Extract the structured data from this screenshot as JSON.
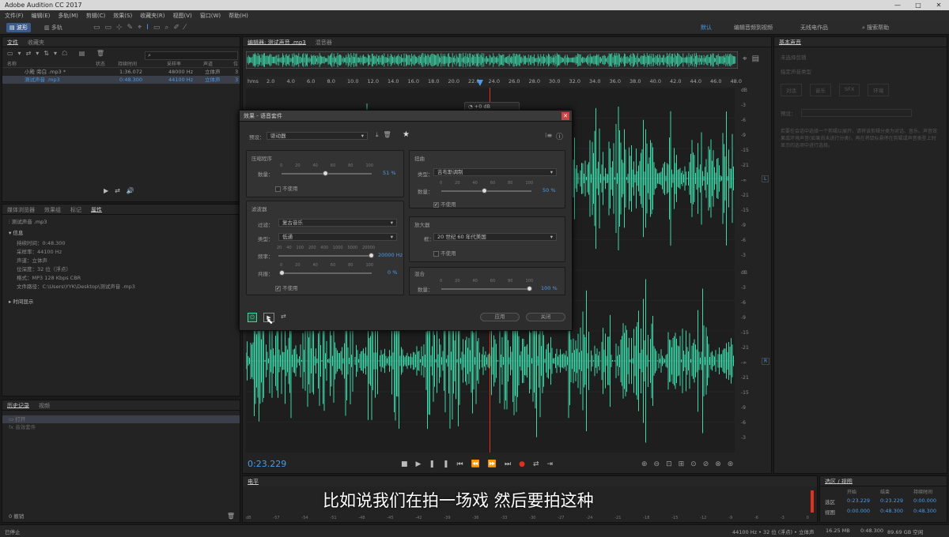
{
  "app": {
    "title": "Adobe Audition CC 2017",
    "win_min": "—",
    "win_max": "□",
    "win_close": "✕"
  },
  "menu": [
    "文件(F)",
    "编辑(E)",
    "多轨(M)",
    "剪辑(C)",
    "效果(S)",
    "收藏夹(R)",
    "视图(V)",
    "窗口(W)",
    "帮助(H)"
  ],
  "toolbar": {
    "mode_wave": "波形",
    "mode_multi": "多轨",
    "workspace": "默认",
    "workspace2": "编辑音频到视频",
    "workspace3": "无线电作品",
    "search_placeholder": "搜索帮助"
  },
  "files": {
    "tabs": [
      "文件",
      "收藏夹"
    ],
    "headers": [
      "名称",
      "状态",
      "持续时间",
      "采样率",
      "声道",
      "位"
    ],
    "rows": [
      {
        "name": "小殿 旁白 .mp3 *",
        "dur": "1:36.072",
        "rate": "48000 Hz",
        "ch": "立体声",
        "bits": "3"
      },
      {
        "name": "测试声音 .mp3",
        "dur": "0:48.300",
        "rate": "44100 Hz",
        "ch": "立体声",
        "bits": "3"
      }
    ]
  },
  "props": {
    "tabs": [
      "媒体浏览器",
      "效果组",
      "标记",
      "属性"
    ],
    "filename": "测试声音 .mp3",
    "section": "信息",
    "items": [
      "持续时间：0:48.300",
      "采样率：44100 Hz",
      "声道：立体声",
      "位深度：32 位（浮点）",
      "格式：MP3 128 Kbps CBR",
      "文件路径：C:\\Users\\YYK\\Desktop\\测试声音 .mp3"
    ],
    "section2": "时间显示"
  },
  "history": {
    "tabs": [
      "历史记录",
      "视频"
    ],
    "items": [
      "打开",
      "音效套件"
    ],
    "footer": "0 撤销"
  },
  "status": {
    "left": "已停止",
    "info": [
      "44100 Hz • 32 位 (浮点) • 立体声",
      "16.25 MB",
      "0:48.300",
      "89.69 GB 空闲"
    ]
  },
  "editor": {
    "tab": "编辑器: 测试声音 .mp3",
    "tab2": "混音器",
    "time_unit": "hms",
    "ruler": [
      "2.0",
      "4.0",
      "6.0",
      "8.0",
      "10.0",
      "12.0",
      "14.0",
      "16.0",
      "18.0",
      "20.0",
      "22.0",
      "24.0",
      "26.0",
      "28.0",
      "30.0",
      "32.0",
      "34.0",
      "36.0",
      "38.0",
      "40.0",
      "42.0",
      "44.0",
      "46.0",
      "48.0"
    ],
    "db_labels": [
      "dB",
      "-3",
      "-6",
      "-9",
      "-15",
      "-21",
      "-∞",
      "-21",
      "-15",
      "-9",
      "-6",
      "-3"
    ],
    "time_display": "0:23.229",
    "hud_db": "+0 dB"
  },
  "dialog": {
    "title": "效果 - 语音套件",
    "preset_label": "预设：",
    "preset_value": "驱动器",
    "compressor": {
      "title": "压缩程序",
      "amount_label": "数量：",
      "value": "51",
      "unit": "%",
      "ticks": [
        "0",
        "20",
        "40",
        "60",
        "80",
        "100"
      ],
      "bypass": "不使用"
    },
    "filter": {
      "title": "滤波器",
      "filter_label": "过滤：",
      "filter_value": "复古音乐",
      "type_label": "类型：",
      "type_value": "低通",
      "freq_label": "频率：",
      "freq_value": "20000",
      "freq_unit": "Hz",
      "freq_ticks": [
        "20",
        "40",
        "100",
        "200",
        "400",
        "1000",
        "5000",
        "20000"
      ],
      "res_label": "共振：",
      "res_value": "0",
      "res_unit": "%",
      "res_ticks": [
        "0",
        "20",
        "40",
        "60",
        "80",
        "100"
      ],
      "bypass": "不使用"
    },
    "distortion": {
      "title": "扭曲",
      "type_label": "类型：",
      "type_value": "吉布斯调制",
      "amount_label": "数量：",
      "value": "50",
      "unit": "%",
      "ticks": [
        "0",
        "20",
        "40",
        "60",
        "80",
        "100"
      ],
      "bypass": "不使用"
    },
    "reverb": {
      "title": "放大器",
      "type_label": "框：",
      "type_value": "20 世纪 60 年代美国",
      "bypass": "不使用"
    },
    "mix": {
      "title": "混合",
      "amount_label": "数量：",
      "value": "100",
      "unit": "%",
      "ticks": [
        "0",
        "20",
        "40",
        "60",
        "80",
        "100"
      ]
    },
    "apply": "应用",
    "close": "关闭"
  },
  "levels": {
    "title": "电平",
    "ticks": [
      "dB",
      "-57",
      "-54",
      "-51",
      "-48",
      "-45",
      "-42",
      "-39",
      "-36",
      "-33",
      "-30",
      "-27",
      "-24",
      "-21",
      "-18",
      "-15",
      "-12",
      "-9",
      "-6",
      "-3",
      "0"
    ]
  },
  "selection": {
    "title": "选区 / 视图",
    "headers": [
      "开始",
      "结束",
      "持续时间"
    ],
    "rows": [
      {
        "label": "选区",
        "start": "0:23.229",
        "end": "0:23.229",
        "dur": "0:00.000"
      },
      {
        "label": "视图",
        "start": "0:00.000",
        "end": "0:48.300",
        "dur": "0:48.300"
      }
    ]
  },
  "right": {
    "title": "基本声音",
    "hint1": "未选择剪辑",
    "hint2": "指定声音类型",
    "types": [
      "对话",
      "音乐",
      "SFX",
      "环境"
    ],
    "preset_label": "预设：",
    "desc": "若要在会话中选择一个剪辑以展开，请将该剪辑分类为对话、音乐、声音效果或环境声音(如果尚未进行分类)，再在将鼠标悬停在剪辑或声音类型上时显示的选项中进行选择。"
  },
  "subtitle": "比如说我们在拍一场戏 然后要拍这种",
  "colors": {
    "wave": "#3cd8a8",
    "accent": "#4c9be8",
    "playhead": "#e03020"
  }
}
